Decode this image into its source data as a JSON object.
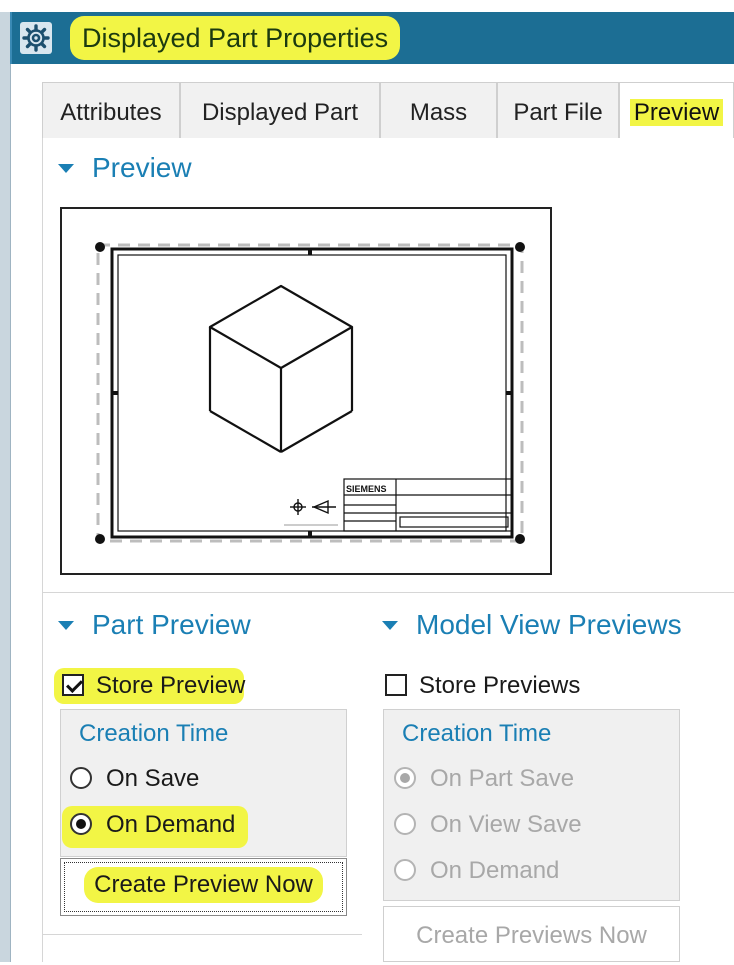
{
  "window": {
    "title": "Displayed Part Properties",
    "icon": "gear-icon"
  },
  "tabs": [
    {
      "label": "Attributes"
    },
    {
      "label": "Displayed Part"
    },
    {
      "label": "Mass"
    },
    {
      "label": "Part File"
    },
    {
      "label": "Preview",
      "active": true
    }
  ],
  "preview_section": {
    "title": "Preview",
    "drawing_title_block_brand": "SIEMENS"
  },
  "part_preview": {
    "title": "Part Preview",
    "store_preview_label": "Store Preview",
    "store_preview_checked": true,
    "creation_time_title": "Creation Time",
    "options": [
      {
        "label": "On Save",
        "selected": false
      },
      {
        "label": "On Demand",
        "selected": true
      }
    ],
    "create_button": "Create Preview Now"
  },
  "model_view_previews": {
    "title": "Model View Previews",
    "store_previews_label": "Store Previews",
    "store_previews_checked": false,
    "creation_time_title": "Creation Time",
    "options": [
      {
        "label": "On Part Save",
        "selected": true
      },
      {
        "label": "On View Save",
        "selected": false
      },
      {
        "label": "On Demand",
        "selected": false
      }
    ],
    "create_button": "Create Previews Now"
  },
  "colors": {
    "accent": "#1a7fb4",
    "titlebar": "#1c6e94",
    "highlight": "#f2f545"
  }
}
